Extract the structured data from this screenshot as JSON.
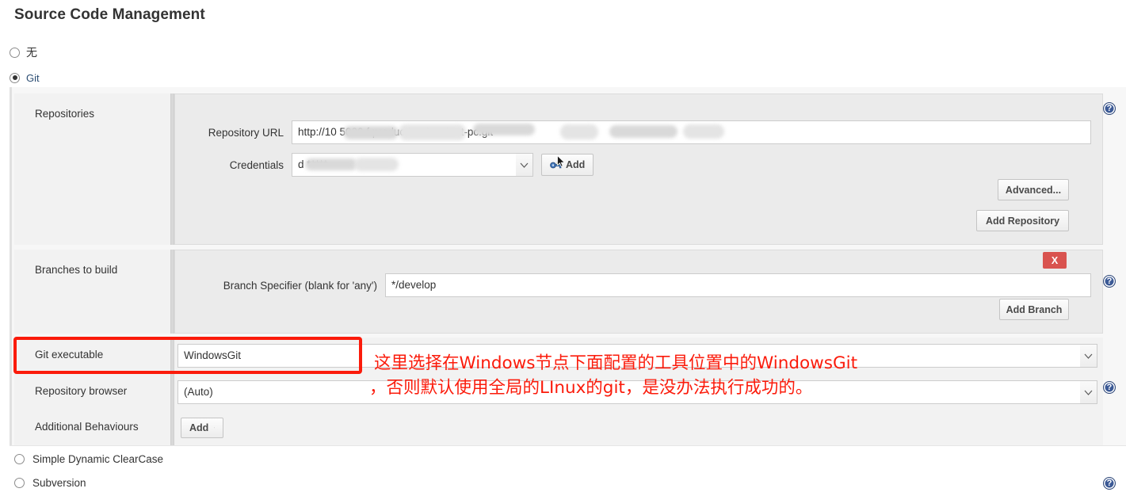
{
  "page": {
    "title": "Source Code Management"
  },
  "scm_options": [
    {
      "label": "无",
      "checked": false,
      "name": "none"
    },
    {
      "label": "Git",
      "checked": true,
      "name": "git"
    }
  ],
  "repositories": {
    "section_label": "Repositories",
    "repository_url": {
      "label": "Repository URL",
      "value": "http://10                    5000  f   production  /trunk            nt-pc.git"
    },
    "credentials": {
      "label": "Credentials",
      "value": "d                     *****",
      "add_button": "Add",
      "add_icon": "key-icon"
    },
    "advanced_button": "Advanced...",
    "add_repository_button": "Add Repository"
  },
  "branches": {
    "section_label": "Branches to build",
    "branch_specifier": {
      "label": "Branch Specifier (blank for 'any')",
      "value": "*/develop"
    },
    "delete_button": "X",
    "add_branch_button": "Add Branch"
  },
  "git_executable": {
    "label": "Git executable",
    "value": "WindowsGit"
  },
  "repository_browser": {
    "label": "Repository browser",
    "value": "(Auto)"
  },
  "additional_behaviours": {
    "label": "Additional Behaviours",
    "add_button": "Add",
    "caret": "▼"
  },
  "other_scm_options": [
    {
      "label": "Simple Dynamic ClearCase",
      "checked": false,
      "name": "simple-dynamic-clearcase"
    },
    {
      "label": "Subversion",
      "checked": false,
      "name": "subversion"
    }
  ],
  "annotation": {
    "line1": "这里选择在Windows节点下面配置的工具位置中的WindowsGit",
    "line2": "，否则默认使用全局的LInux的git，是没办法执行成功的。",
    "color": "#fb1b0b"
  },
  "help_icon": "?",
  "colors": {
    "accent_red": "#fb1b0b",
    "delete_red": "#d9534f",
    "help_blue": "#3c5a96",
    "panel_bg": "#ebebeb",
    "body_bg": "#f2f2f2"
  }
}
